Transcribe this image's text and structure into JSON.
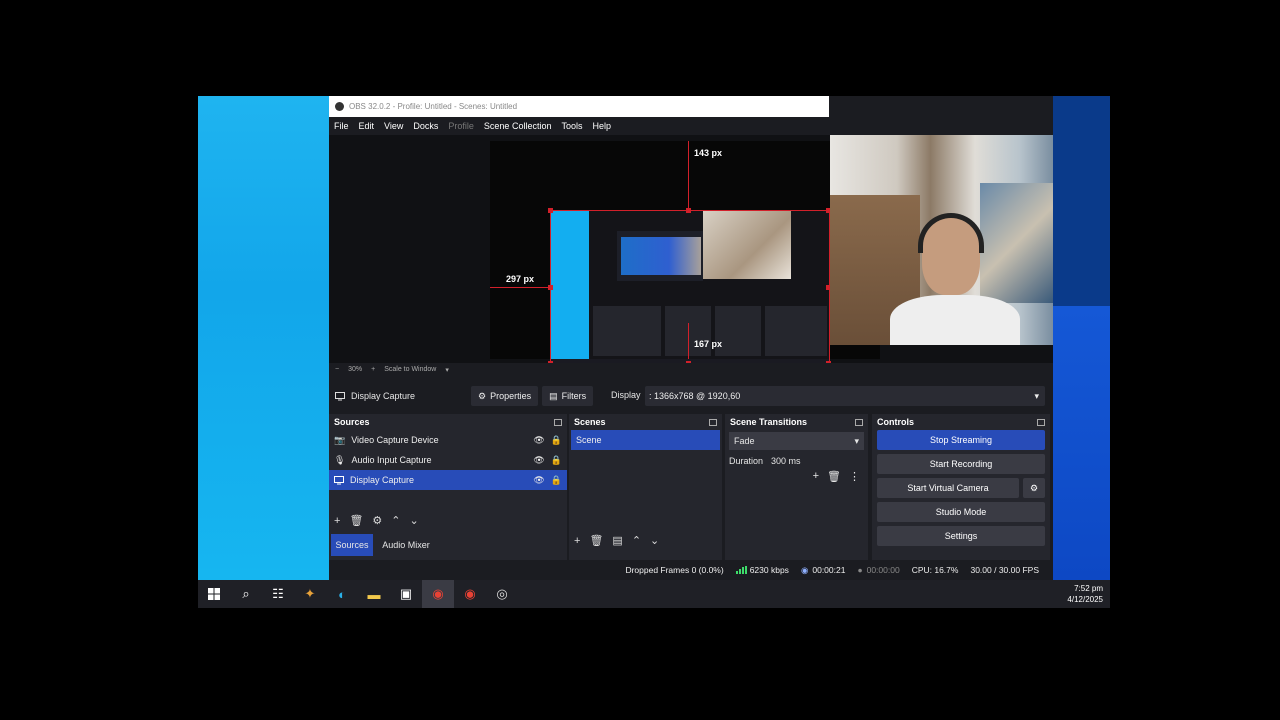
{
  "window": {
    "title": "OBS 32.0.2 - Profile: Untitled - Scenes: Untitled"
  },
  "menu": {
    "items": [
      "File",
      "Edit",
      "View",
      "Docks",
      "Profile",
      "Scene Collection",
      "Tools",
      "Help"
    ]
  },
  "preview": {
    "top_distance": "143 px",
    "left_distance": "297 px",
    "bottom_distance": "167 px"
  },
  "zoom": {
    "minus": "−",
    "value": "30%",
    "plus": "+",
    "fit": "Scale to Window"
  },
  "context": {
    "source_name": "Display Capture",
    "properties": "Properties",
    "filters": "Filters",
    "display_label": "Display",
    "display_value": ": 1366x768 @ 1920,60"
  },
  "sources": {
    "title": "Sources",
    "items": [
      {
        "label": "Video Capture Device",
        "icon": "camera-icon"
      },
      {
        "label": "Audio Input Capture",
        "icon": "microphone-icon"
      },
      {
        "label": "Display Capture",
        "icon": "monitor-icon"
      }
    ],
    "selected_index": 2,
    "tabs": [
      "Sources",
      "Audio Mixer"
    ]
  },
  "scenes": {
    "title": "Scenes",
    "items": [
      "Scene"
    ]
  },
  "transitions": {
    "title": "Scene Transitions",
    "type": "Fade",
    "duration_label": "Duration",
    "duration_value": "300 ms"
  },
  "controls": {
    "title": "Controls",
    "stop_streaming": "Stop Streaming",
    "start_recording": "Start Recording",
    "start_virtual_camera": "Start Virtual Camera",
    "studio_mode": "Studio Mode",
    "settings": "Settings"
  },
  "status": {
    "dropped": "Dropped Frames 0 (0.0%)",
    "bitrate": "6230 kbps",
    "stream_time": "00:00:21",
    "rec_time": "00:00:00",
    "cpu": "CPU: 16.7%",
    "fps": "30.00 / 30.00 FPS"
  },
  "taskbar": {
    "time": "7:52 pm",
    "date": "4/12/2025"
  },
  "colors": {
    "accent": "#284cb8",
    "guide": "#d2202a",
    "stream_green": "#3ddc6a"
  }
}
